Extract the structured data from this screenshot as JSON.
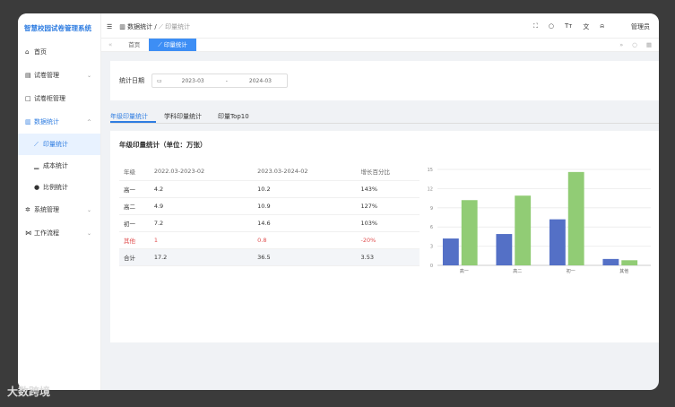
{
  "app": {
    "title": "智慧校园试卷管理系统",
    "user": "管理员"
  },
  "sidebar": {
    "items": [
      {
        "label": "首页",
        "icon": "home-icon"
      },
      {
        "label": "试卷管理",
        "icon": "list-icon"
      },
      {
        "label": "试卷柜管理",
        "icon": "folder-icon"
      },
      {
        "label": "数据统计",
        "icon": "chart-icon"
      },
      {
        "label": "印量统计",
        "icon": "line-chart-icon"
      },
      {
        "label": "成本统计",
        "icon": "bar-chart-icon"
      },
      {
        "label": "比例统计",
        "icon": "pie-chart-icon"
      },
      {
        "label": "系统管理",
        "icon": "gear-icon"
      },
      {
        "label": "工作流程",
        "icon": "flow-icon"
      }
    ]
  },
  "header": {
    "breadcrumb": [
      "数据统计",
      "印量统计"
    ]
  },
  "tabs": [
    "首页",
    "印量统计"
  ],
  "filter": {
    "label": "统计日期",
    "start": "2023-03",
    "sep": "-",
    "end": "2024-03"
  },
  "content_tabs": [
    "年级印量统计",
    "学科印量统计",
    "印量Top10"
  ],
  "panel": {
    "title": "年级印量统计（单位：万张）"
  },
  "table": {
    "headers": [
      "年级",
      "2022.03-2023-02",
      "2023.03-2024-02",
      "增长百分比"
    ],
    "rows": [
      [
        "高一",
        "4.2",
        "10.2",
        "143%"
      ],
      [
        "高二",
        "4.9",
        "10.9",
        "127%"
      ],
      [
        "初一",
        "7.2",
        "14.6",
        "103%"
      ],
      [
        "其他",
        "1",
        "0.8",
        "-20%"
      ],
      [
        "合计",
        "17.2",
        "36.5",
        "3.53"
      ]
    ]
  },
  "chart_data": {
    "type": "bar",
    "categories": [
      "高一",
      "高二",
      "初一",
      "其他"
    ],
    "series": [
      {
        "values": [
          4.2,
          4.9,
          7.2,
          1
        ],
        "color": "#5470c6"
      },
      {
        "values": [
          10.2,
          10.9,
          14.6,
          0.8
        ],
        "color": "#91cc75"
      }
    ],
    "ylim": [
      0,
      15
    ],
    "yticks": [
      0,
      3,
      6,
      9,
      12,
      15
    ],
    "grid": true
  },
  "colors": {
    "accent": "#2f7de1",
    "negative": "#e05050"
  },
  "watermark": "大数跨境"
}
